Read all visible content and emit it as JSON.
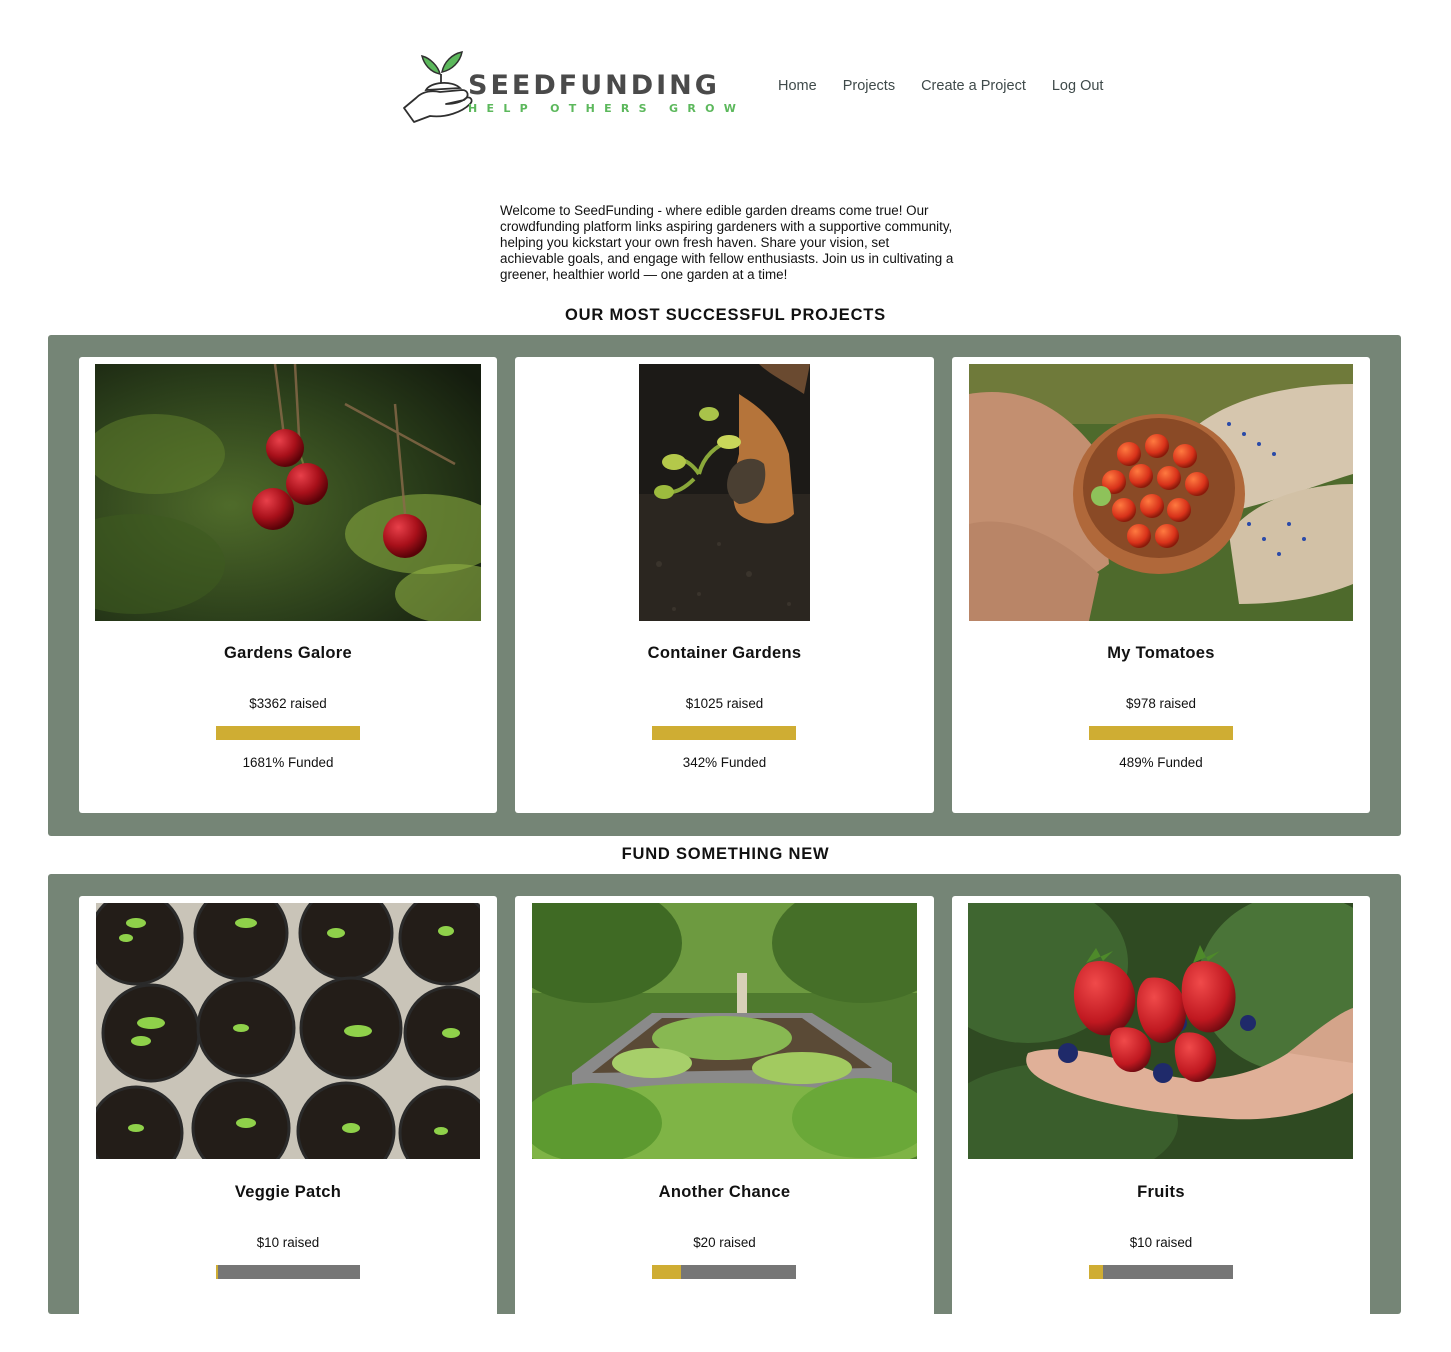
{
  "brand": {
    "name": "SEEDFUNDING",
    "tagline": "HELP OTHERS GROW",
    "colors": {
      "accent": "#5cb85c",
      "title": "#4a4a4a"
    }
  },
  "nav": {
    "items": [
      {
        "label": "Home"
      },
      {
        "label": "Projects"
      },
      {
        "label": "Create a Project"
      },
      {
        "label": "Log Out"
      }
    ]
  },
  "intro": {
    "text": "Welcome to SeedFunding - where edible garden dreams come true! Our crowdfunding platform links aspiring gardeners with a supportive community, helping you kickstart your own fresh haven. Share your vision, set achievable goals, and engage with fellow enthusiasts. Join us in cultivating a greener, healthier world — one garden at a time!"
  },
  "successful": {
    "heading": "OUR MOST SUCCESSFUL PROJECTS",
    "projects": [
      {
        "title": "Gardens Galore",
        "raised": "$3362 raised",
        "funded": "1681% Funded",
        "progress": 1.0,
        "image": "cherries-photo"
      },
      {
        "title": "Container Gardens",
        "raised": "$1025 raised",
        "funded": "342% Funded",
        "progress": 1.0,
        "image": "hands-planting-photo"
      },
      {
        "title": "My Tomatoes",
        "raised": "$978 raised",
        "funded": "489% Funded",
        "progress": 1.0,
        "image": "tomato-bowl-photo"
      }
    ]
  },
  "new": {
    "heading": "FUND SOMETHING NEW",
    "projects": [
      {
        "title": "Veggie Patch",
        "raised": "$10 raised",
        "progress": 0.015,
        "image": "seedling-pots-photo"
      },
      {
        "title": "Another Chance",
        "raised": "$20 raised",
        "progress": 0.2,
        "image": "raised-bed-photo"
      },
      {
        "title": "Fruits",
        "raised": "$10 raised",
        "progress": 0.1,
        "image": "strawberries-hand-photo"
      }
    ]
  },
  "colors": {
    "panel": "#758576",
    "progress_fill": "#cfad33",
    "progress_track": "#767676"
  }
}
